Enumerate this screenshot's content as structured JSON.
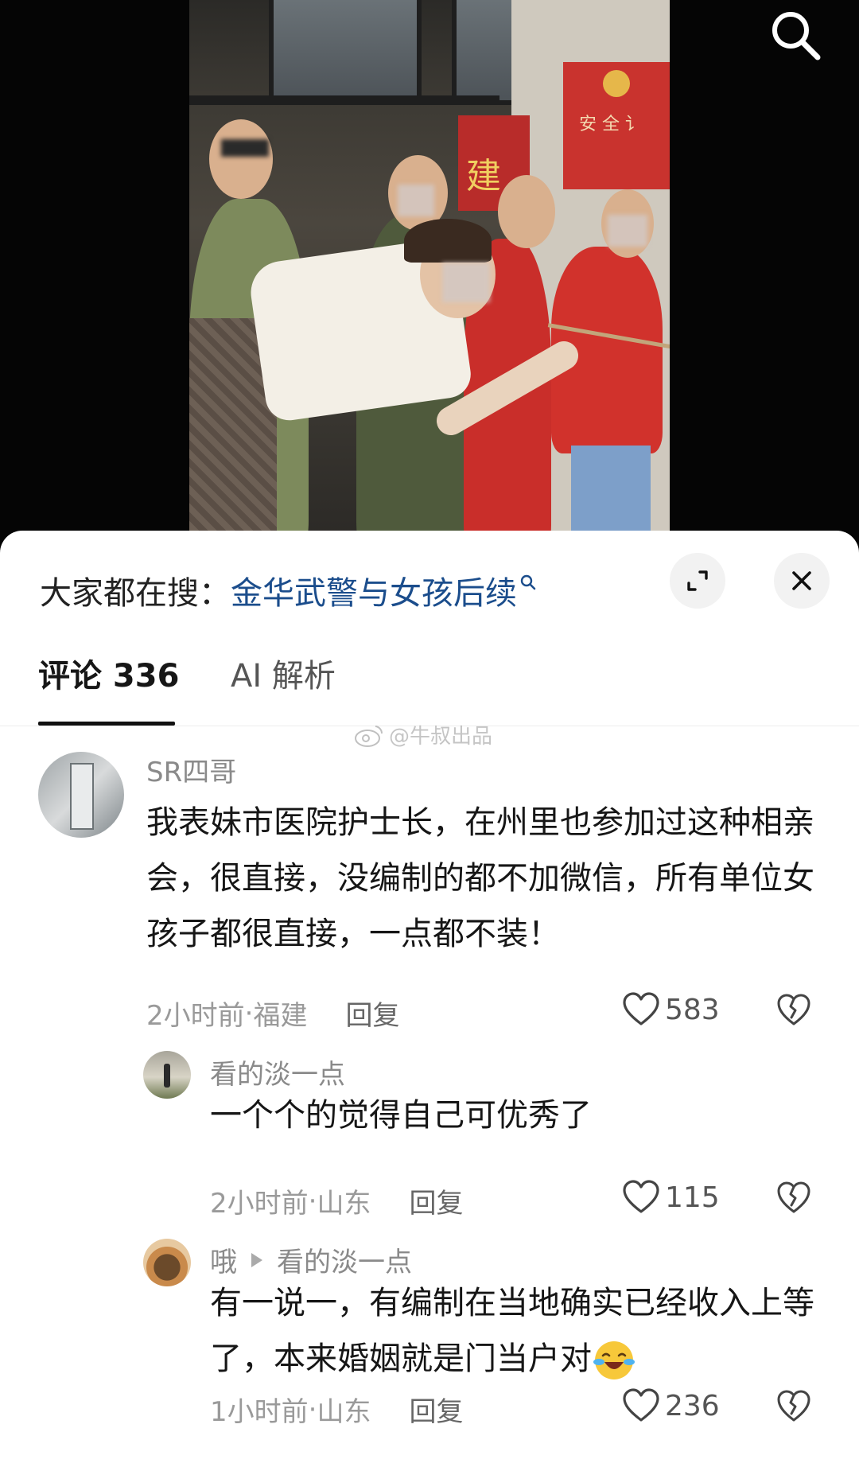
{
  "search_icon": "search-icon",
  "hot_search": {
    "prefix": "大家都在搜：",
    "term": "金华武警与女孩后续",
    "term_icon": "magnifier-icon"
  },
  "buttons": {
    "expand_icon": "expand-icon",
    "close_icon": "close-icon"
  },
  "tabs": [
    {
      "label": "评论 336",
      "active": true
    },
    {
      "label": "AI 解析",
      "active": false
    }
  ],
  "watermark": "@牛叔出品",
  "video_sign_text": "安 全 讠",
  "video_sign_char": "建",
  "comments": [
    {
      "username": "SR四哥",
      "text": "我表妹市医院护士长，在州里也参加过这种相亲会，很直接，没编制的都不加微信，所有单位女孩子都很直接，一点都不装！",
      "time": "2小时前",
      "location": "福建",
      "reply": "回复",
      "likes": "583"
    },
    {
      "username": "看的淡一点",
      "text": "一个个的觉得自己可优秀了",
      "time": "2小时前",
      "location": "山东",
      "reply": "回复",
      "likes": "115"
    },
    {
      "username": "哦",
      "reply_to": "看的淡一点",
      "text": "有一说一，有编制在当地确实已经收入上等了，本来婚姻就是门当户对",
      "emoji": "laughing-crying-emoji",
      "time": "1小时前",
      "location": "山东",
      "reply": "回复",
      "likes": "236"
    }
  ],
  "meta_separator": " · "
}
